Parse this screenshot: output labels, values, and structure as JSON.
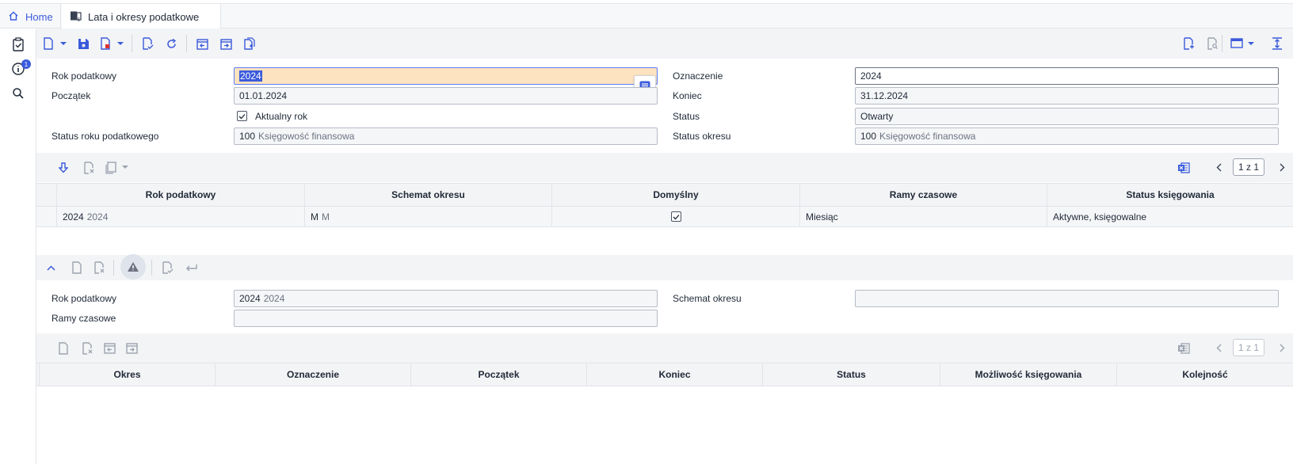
{
  "tabs": {
    "home": "Home",
    "active": "Lata i okresy podatkowe"
  },
  "rail": {
    "info_badge": "1"
  },
  "header_form": {
    "rok_podatkowy_label": "Rok podatkowy",
    "rok_podatkowy_value": "2024",
    "poczatek_label": "Początek",
    "poczatek_value": "01.01.2024",
    "aktualny_rok_label": "Aktualny rok",
    "status_roku_label": "Status roku podatkowego",
    "status_roku_code": "100",
    "status_roku_desc": "Księgowość finansowa",
    "oznaczenie_label": "Oznaczenie",
    "oznaczenie_value": "2024",
    "koniec_label": "Koniec",
    "koniec_value": "31.12.2024",
    "status_label": "Status",
    "status_value": "Otwarty",
    "status_okresu_label": "Status okresu",
    "status_okresu_code": "100",
    "status_okresu_desc": "Księgowość finansowa"
  },
  "grid1": {
    "pager": "1 z 1",
    "columns": [
      "Rok podatkowy",
      "Schemat okresu",
      "Domyślny",
      "Ramy czasowe",
      "Status księgowania"
    ],
    "row": {
      "rok_code": "2024",
      "rok_desc": "2024",
      "schemat_code": "M",
      "schemat_desc": "M",
      "domyslny": true,
      "ramy": "Miesiąc",
      "status": "Aktywne, księgowalne"
    }
  },
  "detail_form": {
    "rok_podatkowy_label": "Rok podatkowy",
    "rok_code": "2024",
    "rok_desc": "2024",
    "ramy_label": "Ramy czasowe",
    "ramy_value": "",
    "schemat_label": "Schemat okresu",
    "schemat_value": ""
  },
  "grid2": {
    "pager": "1 z 1",
    "columns": [
      "Okres",
      "Oznaczenie",
      "Początek",
      "Koniec",
      "Status",
      "Możliwość księgowania",
      "Kolejność"
    ]
  },
  "colors": {
    "accent": "#3b5bdb",
    "focus_field": "#fde3c0",
    "toolbar_bg": "#f3f4f6"
  }
}
